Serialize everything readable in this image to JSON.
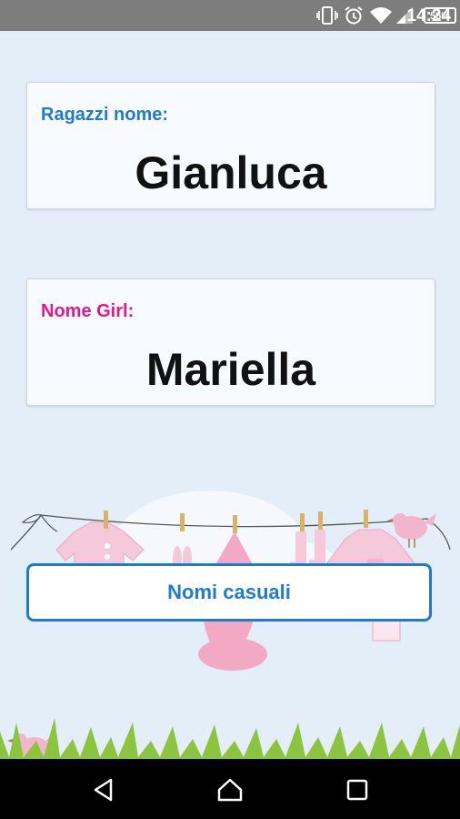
{
  "status_bar": {
    "time": "14:24",
    "battery_percent": "55%",
    "icons": [
      "vibrate-icon",
      "alarm-icon",
      "wifi-icon",
      "signal-icon",
      "battery-icon"
    ]
  },
  "boy_card": {
    "label": "Ragazzi nome:",
    "name": "Gianluca",
    "label_color": "#1f7ad0"
  },
  "girl_card": {
    "label": "Nome Girl:",
    "name": "Mariella",
    "label_color": "#e3188f"
  },
  "random_button": {
    "label": "Nomi casuali",
    "color": "#1f7ad0"
  },
  "nav_bar": {
    "icons": [
      "back-icon",
      "home-icon",
      "recents-icon"
    ]
  }
}
